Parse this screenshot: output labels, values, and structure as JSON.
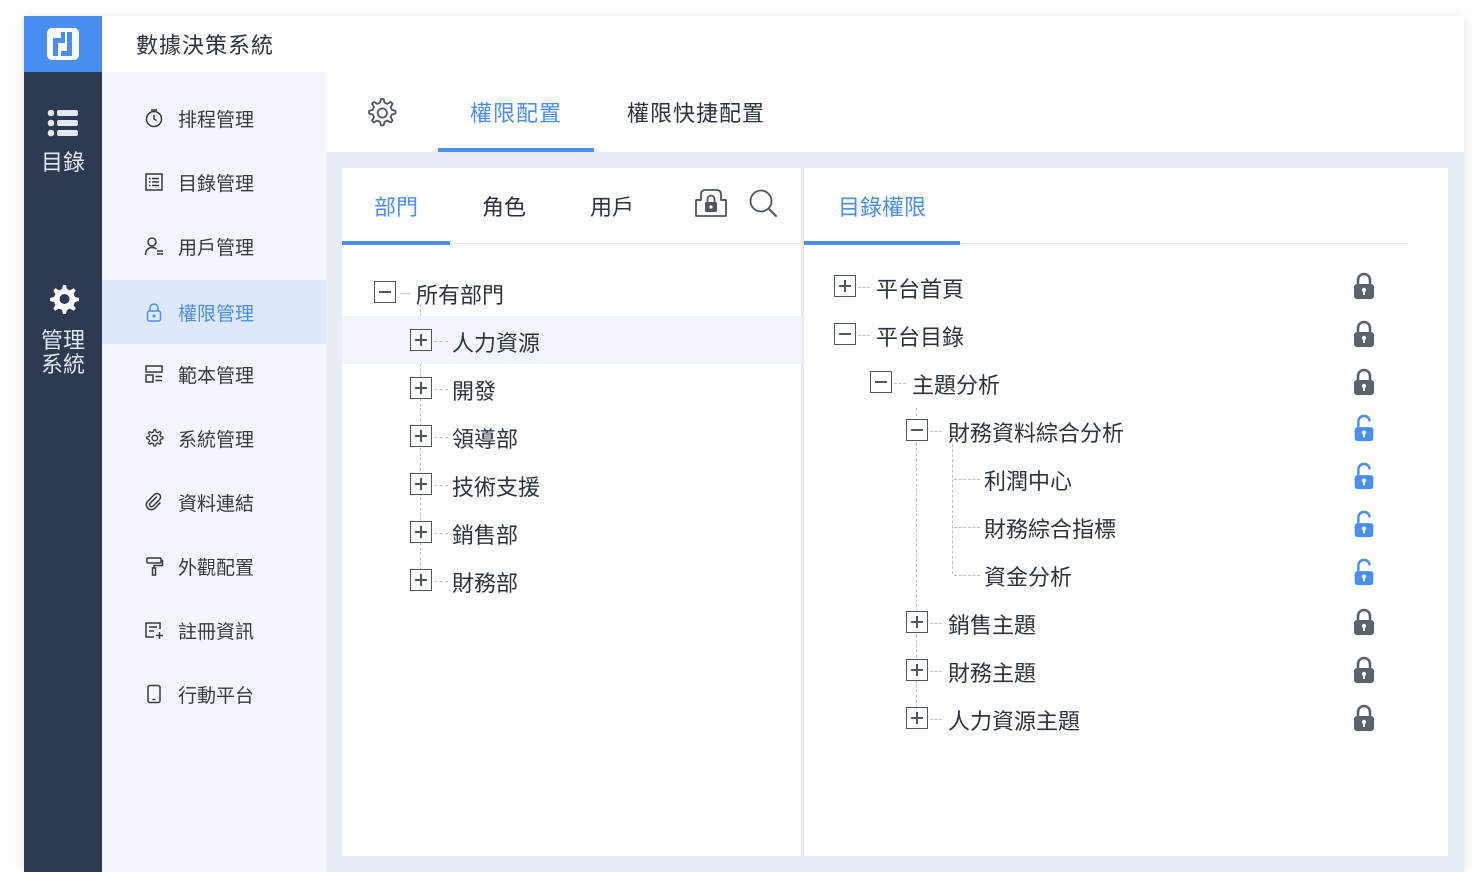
{
  "app": {
    "title": "數據決策系統",
    "accent": "#4a8ef1",
    "rail_bg": "#2d3a52"
  },
  "rail": {
    "items": [
      {
        "label": "目錄",
        "icon": "list-icon"
      },
      {
        "label": "管理\n系統",
        "label_line1": "管理",
        "label_line2": "系統",
        "icon": "gear-icon"
      }
    ]
  },
  "menu": {
    "items": [
      {
        "label": "排程管理",
        "icon": "timer-icon"
      },
      {
        "label": "目錄管理",
        "icon": "list-doc-icon"
      },
      {
        "label": "用戶管理",
        "icon": "user-icon"
      },
      {
        "label": "權限管理",
        "icon": "lock-icon",
        "active": true
      },
      {
        "label": "範本管理",
        "icon": "template-icon"
      },
      {
        "label": "系統管理",
        "icon": "gear-icon"
      },
      {
        "label": "資料連結",
        "icon": "link-icon"
      },
      {
        "label": "外觀配置",
        "icon": "paint-roller-icon"
      },
      {
        "label": "註冊資訊",
        "icon": "register-icon"
      },
      {
        "label": "行動平台",
        "icon": "mobile-icon"
      }
    ]
  },
  "content_tabs": {
    "settings_icon": "gear-icon",
    "tabs": [
      {
        "label": "權限配置",
        "active": true
      },
      {
        "label": "權限快捷配置",
        "active": false
      }
    ]
  },
  "left_panel": {
    "tabs": [
      {
        "label": "部門",
        "active": true
      },
      {
        "label": "角色",
        "active": false
      },
      {
        "label": "用戶",
        "active": false
      }
    ],
    "tool_icons": [
      "lock-folder-icon",
      "search-icon"
    ],
    "tree": {
      "root": "所有部門",
      "children": [
        "人力資源",
        "開發",
        "領導部",
        "技術支援",
        "銷售部",
        "財務部"
      ],
      "highlighted": "人力資源"
    }
  },
  "right_panel": {
    "tabs": [
      {
        "label": "目錄權限",
        "active": true
      }
    ],
    "tree": [
      {
        "label": "平台首頁",
        "level": 0,
        "toggle": "plus",
        "locked": true
      },
      {
        "label": "平台目錄",
        "level": 0,
        "toggle": "minus",
        "locked": true
      },
      {
        "label": "主題分析",
        "level": 1,
        "toggle": "minus",
        "locked": true
      },
      {
        "label": "財務資料綜合分析",
        "level": 2,
        "toggle": "minus",
        "locked": false
      },
      {
        "label": "利潤中心",
        "level": 3,
        "toggle": "none",
        "locked": false
      },
      {
        "label": "財務綜合指標",
        "level": 3,
        "toggle": "none",
        "locked": false
      },
      {
        "label": "資金分析",
        "level": 3,
        "toggle": "none",
        "locked": false
      },
      {
        "label": "銷售主題",
        "level": 2,
        "toggle": "plus",
        "locked": true
      },
      {
        "label": "財務主題",
        "level": 2,
        "toggle": "plus",
        "locked": true
      },
      {
        "label": "人力資源主題",
        "level": 2,
        "toggle": "plus",
        "locked": true
      }
    ]
  }
}
